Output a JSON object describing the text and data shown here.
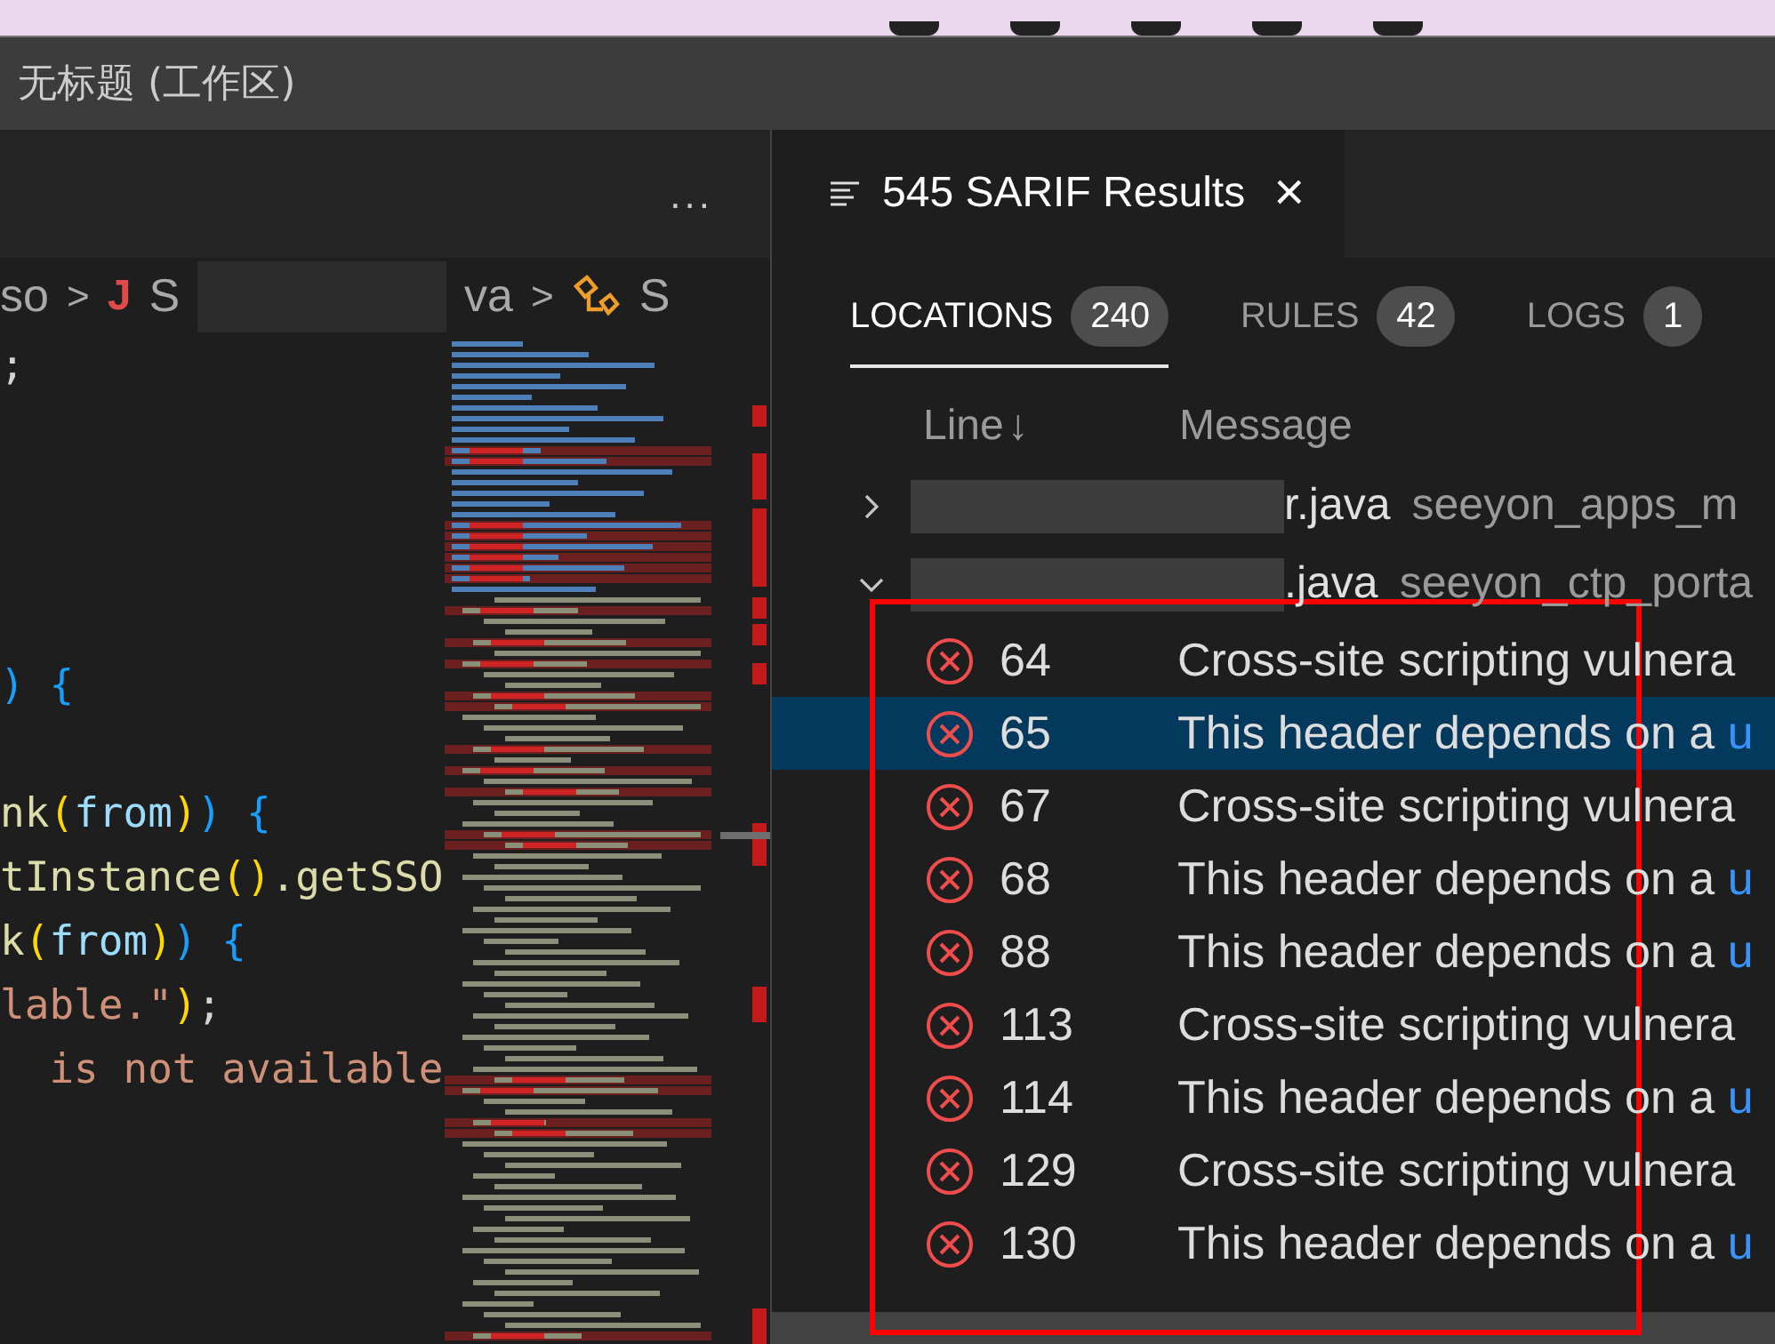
{
  "window": {
    "title": "无标题 (工作区)"
  },
  "editor": {
    "more": "...",
    "breadcrumb": [
      {
        "kind": "text",
        "text": "so"
      },
      {
        "kind": "sep",
        "text": ">"
      },
      {
        "kind": "java",
        "text": "J"
      },
      {
        "kind": "text",
        "text": "S"
      },
      {
        "kind": "redacted"
      },
      {
        "kind": "text",
        "text": "va"
      },
      {
        "kind": "sep",
        "text": ">"
      },
      {
        "kind": "symbol"
      },
      {
        "kind": "text",
        "text": "S"
      }
    ],
    "lines": [
      {
        "kind": "code",
        "tokens": [
          {
            "text": ";",
            "color": "#d4d4d4"
          }
        ]
      },
      {
        "kind": "blank"
      },
      {
        "kind": "blank"
      },
      {
        "kind": "blank"
      },
      {
        "kind": "blank"
      },
      {
        "kind": "code",
        "tokens": [
          {
            "text": ")",
            "color": "#179fff"
          },
          {
            "text": " {",
            "color": "#179fff"
          }
        ]
      },
      {
        "kind": "blank"
      },
      {
        "kind": "code",
        "tokens": [
          {
            "text": "nk",
            "color": "#dcdcaa"
          },
          {
            "text": "(",
            "color": "#ffd700"
          },
          {
            "text": "from",
            "color": "#9cdcfe"
          },
          {
            "text": ")",
            "color": "#ffd700"
          },
          {
            "text": ")",
            "color": "#179fff"
          },
          {
            "text": " {",
            "color": "#179fff"
          }
        ]
      },
      {
        "kind": "code",
        "tokens": [
          {
            "text": "tInstance",
            "color": "#dcdcaa"
          },
          {
            "text": "()",
            "color": "#ffd700"
          },
          {
            "text": ".getSSO",
            "color": "#dcdcaa"
          }
        ]
      },
      {
        "kind": "code",
        "tokens": [
          {
            "text": "k",
            "color": "#dcdcaa"
          },
          {
            "text": "(",
            "color": "#ffd700"
          },
          {
            "text": "from",
            "color": "#9cdcfe"
          },
          {
            "text": ")",
            "color": "#ffd700"
          },
          {
            "text": ")",
            "color": "#179fff"
          },
          {
            "text": " {",
            "color": "#179fff"
          }
        ]
      },
      {
        "kind": "code",
        "tokens": [
          {
            "text": "lable.\"",
            "color": "#ce9178"
          },
          {
            "text": ")",
            "color": "#ffd700"
          },
          {
            "text": ";",
            "color": "#d4d4d4"
          }
        ]
      },
      {
        "kind": "code",
        "tokens": [
          {
            "text": "  is not available",
            "color": "#ce9178"
          }
        ]
      }
    ]
  },
  "panel": {
    "tab": {
      "title": "545 SARIF Results",
      "close": "×"
    },
    "tabs": [
      {
        "label": "LOCATIONS",
        "count": "240",
        "selected": true
      },
      {
        "label": "RULES",
        "count": "42",
        "selected": false
      },
      {
        "label": "LOGS",
        "count": "1",
        "selected": false
      }
    ],
    "columns": [
      {
        "label": "Line",
        "sort": "↓"
      },
      {
        "label": "Message"
      }
    ],
    "files": [
      {
        "name": "r.java",
        "project": "seeyon_apps_m",
        "expanded": false
      },
      {
        "name": ".java",
        "project": "seeyon_ctp_porta",
        "expanded": true
      }
    ],
    "results": [
      {
        "line": "64",
        "message": "Cross-site scripting vulnera",
        "selected": false
      },
      {
        "line": "65",
        "message": "This header depends on a",
        "link": "u",
        "selected": true
      },
      {
        "line": "67",
        "message": "Cross-site scripting vulnera",
        "selected": false
      },
      {
        "line": "68",
        "message": "This header depends on a",
        "link": "u",
        "selected": false
      },
      {
        "line": "88",
        "message": "This header depends on a",
        "link": "u",
        "selected": false
      },
      {
        "line": "113",
        "message": "Cross-site scripting vulnera",
        "selected": false
      },
      {
        "line": "114",
        "message": "This header depends on a",
        "link": "u",
        "selected": false
      },
      {
        "line": "129",
        "message": "Cross-site scripting vulnera",
        "selected": false
      },
      {
        "line": "130",
        "message": "This header depends on a",
        "link": "u",
        "selected": false
      }
    ]
  }
}
